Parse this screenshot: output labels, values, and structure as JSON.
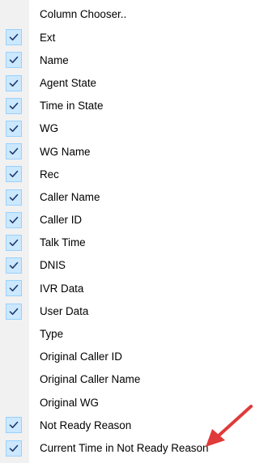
{
  "menu": {
    "items": [
      {
        "label": "Column Chooser..",
        "checked": false
      },
      {
        "label": "Ext",
        "checked": true
      },
      {
        "label": "Name",
        "checked": true
      },
      {
        "label": "Agent State",
        "checked": true
      },
      {
        "label": "Time in State",
        "checked": true
      },
      {
        "label": "WG",
        "checked": true
      },
      {
        "label": "WG Name",
        "checked": true
      },
      {
        "label": "Rec",
        "checked": true
      },
      {
        "label": "Caller Name",
        "checked": true
      },
      {
        "label": "Caller ID",
        "checked": true
      },
      {
        "label": "Talk Time",
        "checked": true
      },
      {
        "label": "DNIS",
        "checked": true
      },
      {
        "label": "IVR Data",
        "checked": true
      },
      {
        "label": "User Data",
        "checked": true
      },
      {
        "label": "Type",
        "checked": false
      },
      {
        "label": "Original Caller ID",
        "checked": false
      },
      {
        "label": "Original Caller Name",
        "checked": false
      },
      {
        "label": "Original WG",
        "checked": false
      },
      {
        "label": "Not Ready Reason",
        "checked": true
      },
      {
        "label": "Current Time in Not Ready Reason",
        "checked": true
      }
    ]
  },
  "colors": {
    "check_bg": "#cce8ff",
    "check_border": "#99d1ff",
    "check_mark": "#1e3a6e",
    "gutter": "#f1f1f1",
    "annotation_arrow": "#e03a3a"
  },
  "icons": {
    "check": "checkmark-icon",
    "annotation": "red-arrow-icon"
  }
}
